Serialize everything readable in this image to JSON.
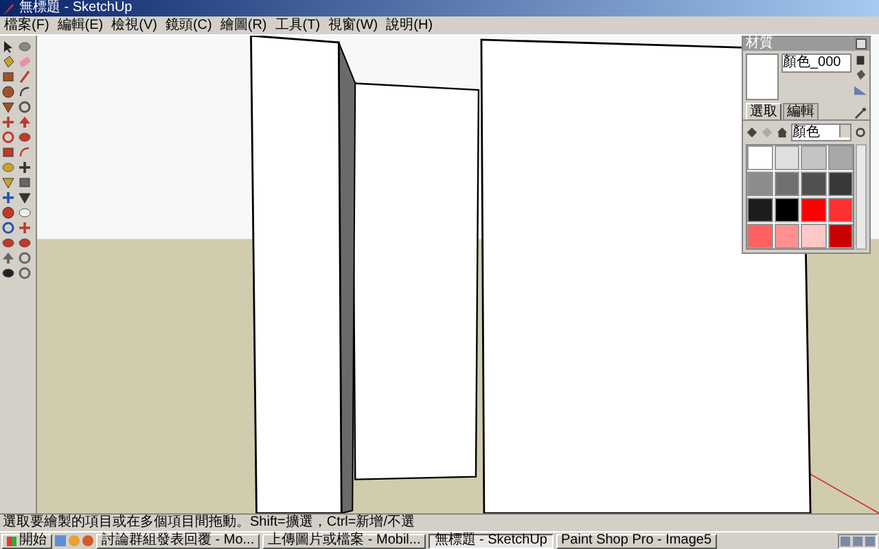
{
  "window": {
    "title": "無標題 - SketchUp"
  },
  "menu": [
    "檔案(F)",
    "編輯(E)",
    "檢視(V)",
    "鏡頭(C)",
    "繪圖(R)",
    "工具(T)",
    "視窗(W)",
    "說明(H)"
  ],
  "materials": {
    "title": "材質",
    "name": "顏色_000",
    "tabs": [
      {
        "label": "選取",
        "selected": true
      },
      {
        "label": "編輯",
        "selected": false
      }
    ],
    "dropdown": "顏色",
    "swatches": [
      {
        "color": "#ffffff"
      },
      {
        "color": "#e0e0e0"
      },
      {
        "color": "#c4c4c4"
      },
      {
        "color": "#a8a8a8"
      },
      {
        "color": "#8c8c8c"
      },
      {
        "color": "#707070"
      },
      {
        "color": "#505050"
      },
      {
        "color": "#383838"
      },
      {
        "color": "#1c1c1c"
      },
      {
        "color": "#000000"
      },
      {
        "color": "#ff0000"
      },
      {
        "color": "#ff3030"
      },
      {
        "color": "#ff6060"
      },
      {
        "color": "#ff9090"
      },
      {
        "color": "#ffc8c8"
      },
      {
        "color": "#c80000"
      }
    ]
  },
  "status_text": "選取要繪製的項目或在多個項目間拖動。Shift=擴選，Ctrl=新增/不選",
  "taskbar": {
    "start": "開始",
    "tasks": [
      {
        "label": "討論群組發表回覆 - Mo...",
        "selected": false
      },
      {
        "label": "上傳圖片或檔案 - Mobil...",
        "selected": false
      },
      {
        "label": "無標題 - SketchUp",
        "selected": true
      },
      {
        "label": "Paint Shop Pro - Image5",
        "selected": false
      }
    ]
  }
}
